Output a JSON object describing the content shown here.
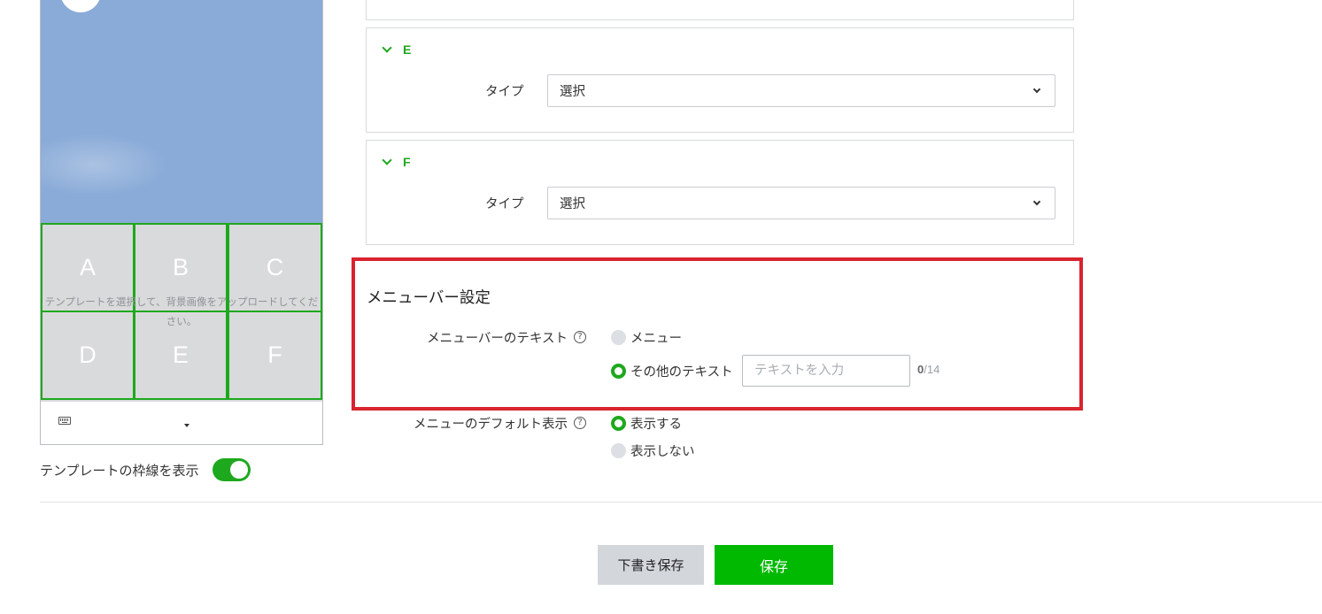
{
  "preview": {
    "cells": [
      "A",
      "B",
      "C",
      "D",
      "E",
      "F"
    ],
    "grid_message": "テンプレートを選択して、背景画像をアップロードしてください。",
    "show_border_label": "テンプレートの枠線を表示",
    "show_border_on": true
  },
  "areas": {
    "card_e": {
      "name": "E",
      "type_label": "タイプ",
      "select_value": "選択"
    },
    "card_f": {
      "name": "F",
      "type_label": "タイプ",
      "select_value": "選択"
    }
  },
  "menubar_settings": {
    "title": "メニューバー設定",
    "text_label": "メニューバーのテキスト",
    "help_glyph": "?",
    "option_menu": "メニュー",
    "option_other": "その他のテキスト",
    "selected": "other",
    "text_input_value": "",
    "text_input_placeholder": "テキストを入力",
    "counter_current": "0",
    "counter_max": "/14"
  },
  "default_display": {
    "label": "メニューのデフォルト表示",
    "help_glyph": "?",
    "option_show": "表示する",
    "option_hide": "表示しない",
    "selected": "show"
  },
  "footer": {
    "draft_label": "下書き保存",
    "save_label": "保存"
  },
  "colors": {
    "accent": "#1ea81e",
    "save_button": "#00b900",
    "highlight": "#d9232f",
    "preview_bg": "#8aabd8"
  }
}
